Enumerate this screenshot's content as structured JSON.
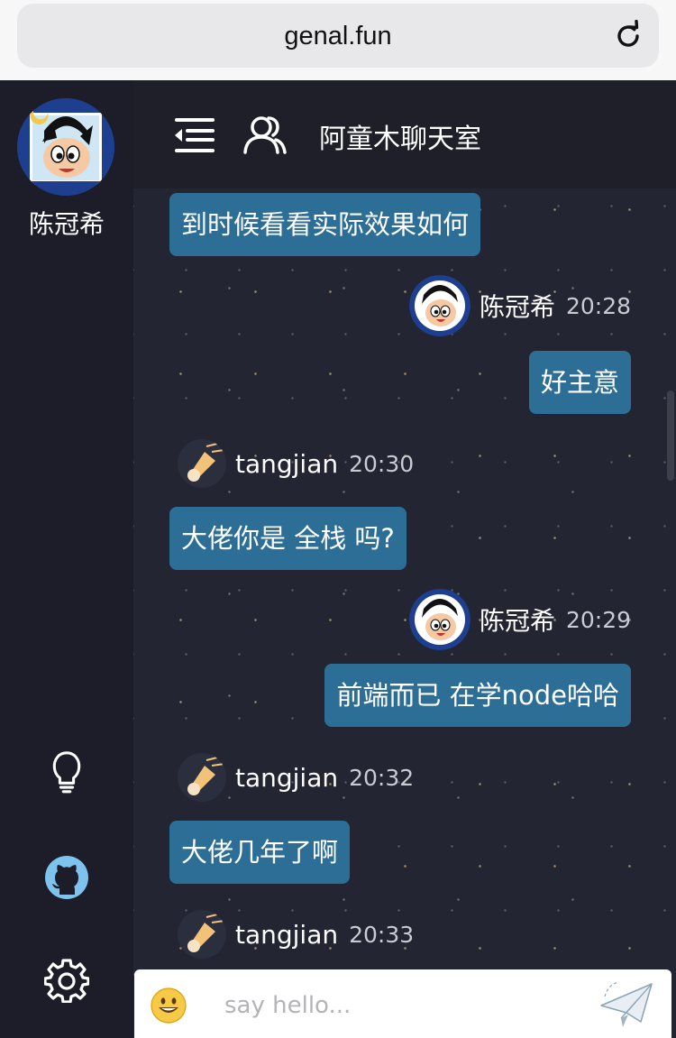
{
  "browser": {
    "url": "genal.fun"
  },
  "sidebar": {
    "user_name": "陈冠希"
  },
  "header": {
    "room_title": "阿童木聊天室"
  },
  "messages": [
    {
      "side": "left",
      "text": "到时候看看实际效果如何"
    },
    {
      "side": "right",
      "user": "陈冠希",
      "time": "20:28",
      "text": "好主意"
    },
    {
      "side": "left",
      "user": "tangjian",
      "time": "20:30",
      "text": "大佬你是 全栈 吗?"
    },
    {
      "side": "right",
      "user": "陈冠希",
      "time": "20:29",
      "text": "前端而已 在学node哈哈"
    },
    {
      "side": "left",
      "user": "tangjian",
      "time": "20:32",
      "text": "大佬几年了啊"
    },
    {
      "side": "left",
      "user": "tangjian",
      "time": "20:33"
    }
  ],
  "input": {
    "placeholder": "say hello..."
  },
  "colors": {
    "bubble": "#2d6e96",
    "sidebar": "#1c1d28",
    "github": "#7ec2ee"
  }
}
